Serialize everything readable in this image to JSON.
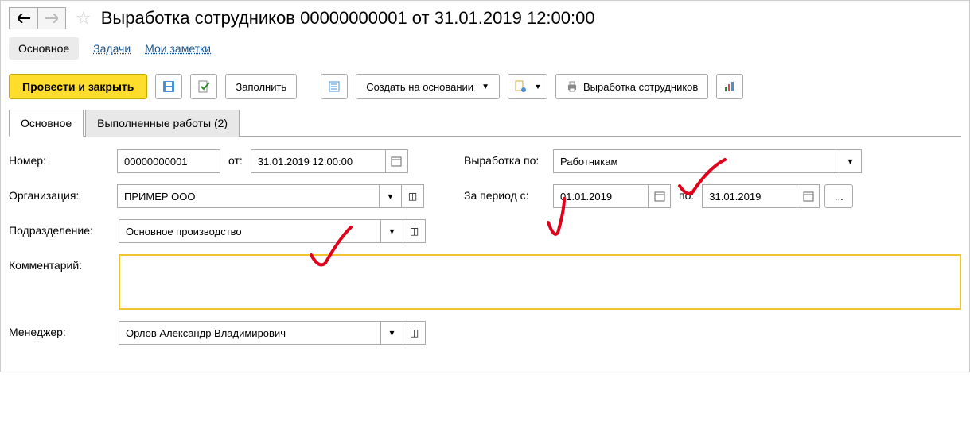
{
  "header": {
    "title": "Выработка сотрудников 00000000001 от 31.01.2019 12:00:00"
  },
  "subnav": {
    "main": "Основное",
    "tasks": "Задачи",
    "notes": "Мои заметки"
  },
  "toolbar": {
    "post_close": "Провести и закрыть",
    "fill": "Заполнить",
    "create_based": "Создать на основании",
    "report": "Выработка сотрудников"
  },
  "tabs": {
    "main": "Основное",
    "works": "Выполненные работы (2)"
  },
  "form": {
    "number": {
      "label": "Номер:",
      "value": "00000000001"
    },
    "from": {
      "label": "от:",
      "value": "31.01.2019 12:00:00"
    },
    "vyrabotka_po": {
      "label": "Выработка по:",
      "value": "Работникам"
    },
    "org": {
      "label": "Организация:",
      "value": "ПРИМЕР ООО"
    },
    "period_from": {
      "label": "За период с:",
      "value": "01.01.2019"
    },
    "period_to": {
      "label": "по:",
      "value": "31.01.2019"
    },
    "period_more": "...",
    "subdiv": {
      "label": "Подразделение:",
      "value": "Основное производство"
    },
    "comment": {
      "label": "Комментарий:",
      "value": ""
    },
    "manager": {
      "label": "Менеджер:",
      "value": "Орлов Александр Владимирович"
    }
  }
}
